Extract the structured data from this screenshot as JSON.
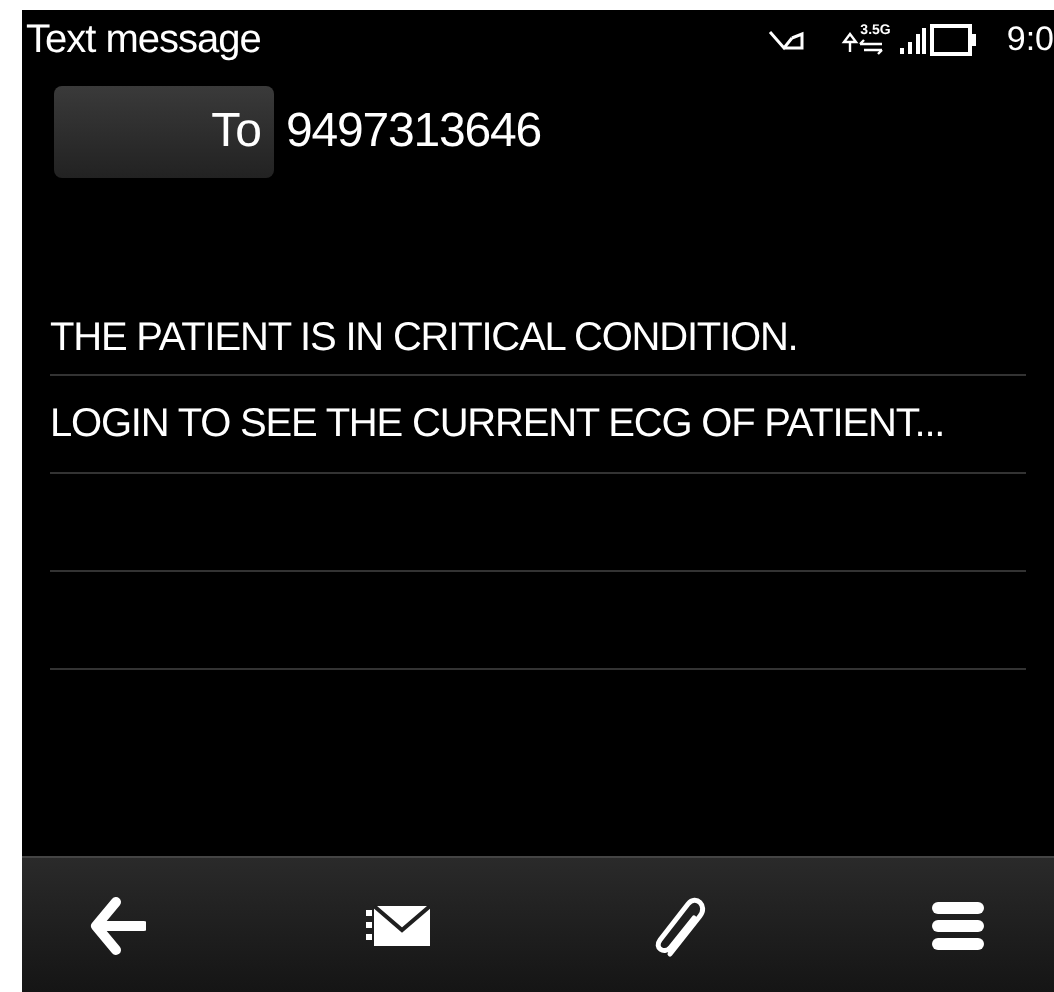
{
  "status_bar": {
    "title": "Text message",
    "network": "3.5G",
    "time": "9:0"
  },
  "recipient": {
    "button": "To",
    "number": "9497313646"
  },
  "message": {
    "lines": [
      "THE PATIENT IS IN CRITICAL CONDITION.",
      "LOGIN TO SEE THE CURRENT ECG OF PATIENT..."
    ]
  }
}
